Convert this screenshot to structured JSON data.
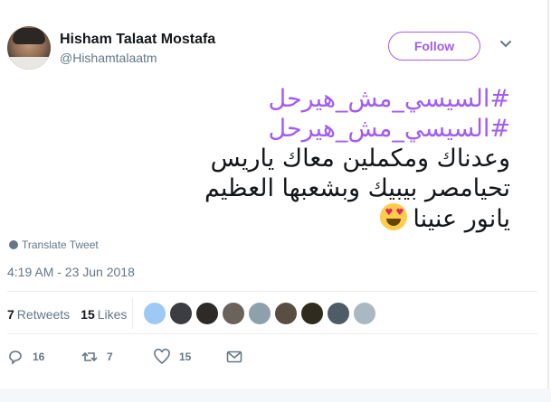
{
  "author": {
    "name": "Hisham Talaat Mostafa",
    "handle": "@Hishamtalaatm"
  },
  "follow_label": "Follow",
  "tweet": {
    "hashtags": [
      "#السيسي_مش_هيرحل",
      "#السيسي_مش_هيرحل"
    ],
    "lines": [
      "وعدناك ومكملين معاك ياريس",
      "تحيامصر بيبيك وبشعبها العظيم",
      "يانور عنينا"
    ],
    "emoji": "smiling-face-heart-eyes"
  },
  "translate_label": "Translate Tweet",
  "timestamp": "4:19 AM - 23 Jun 2018",
  "stats": {
    "retweets_count": "7",
    "retweets_label": "Retweets",
    "likes_count": "15",
    "likes_label": "Likes"
  },
  "likers": [
    "#9ec9f5",
    "#3b3d42",
    "#2e2a28",
    "#6b625c",
    "#8fa0ad",
    "#5a4d42",
    "#2f2b1f",
    "#4f5b66",
    "#aab8c2"
  ],
  "actions": {
    "reply_count": "16",
    "retweet_count": "7",
    "like_count": "15"
  },
  "colors": {
    "accent": "#a35cf0",
    "secondary_text": "#657786"
  }
}
